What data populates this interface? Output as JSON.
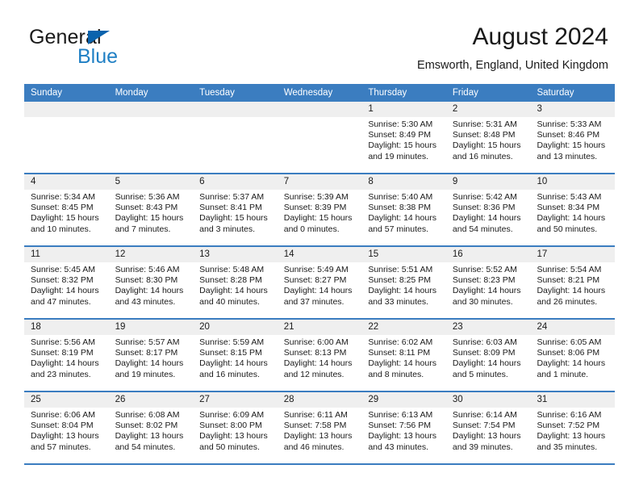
{
  "brand": {
    "name_part1": "General",
    "name_part2": "Blue",
    "flag_icon": "triangle-flag-icon"
  },
  "header": {
    "title": "August 2024",
    "subtitle": "Emsworth, England, United Kingdom"
  },
  "colors": {
    "header_blue": "#3b7dc0",
    "daynum_band": "#efefef",
    "brand_blue": "#1f7fc4",
    "brand_flag": "#0a63ad",
    "text": "#1a1a1a"
  },
  "weekdays": [
    "Sunday",
    "Monday",
    "Tuesday",
    "Wednesday",
    "Thursday",
    "Friday",
    "Saturday"
  ],
  "weeks": [
    [
      {
        "day": "",
        "empty": true,
        "lines": []
      },
      {
        "day": "",
        "empty": true,
        "lines": []
      },
      {
        "day": "",
        "empty": true,
        "lines": []
      },
      {
        "day": "",
        "empty": true,
        "lines": []
      },
      {
        "day": "1",
        "empty": false,
        "lines": [
          "Sunrise: 5:30 AM",
          "Sunset: 8:49 PM",
          "Daylight: 15 hours",
          "and 19 minutes."
        ]
      },
      {
        "day": "2",
        "empty": false,
        "lines": [
          "Sunrise: 5:31 AM",
          "Sunset: 8:48 PM",
          "Daylight: 15 hours",
          "and 16 minutes."
        ]
      },
      {
        "day": "3",
        "empty": false,
        "lines": [
          "Sunrise: 5:33 AM",
          "Sunset: 8:46 PM",
          "Daylight: 15 hours",
          "and 13 minutes."
        ]
      }
    ],
    [
      {
        "day": "4",
        "empty": false,
        "lines": [
          "Sunrise: 5:34 AM",
          "Sunset: 8:45 PM",
          "Daylight: 15 hours",
          "and 10 minutes."
        ]
      },
      {
        "day": "5",
        "empty": false,
        "lines": [
          "Sunrise: 5:36 AM",
          "Sunset: 8:43 PM",
          "Daylight: 15 hours",
          "and 7 minutes."
        ]
      },
      {
        "day": "6",
        "empty": false,
        "lines": [
          "Sunrise: 5:37 AM",
          "Sunset: 8:41 PM",
          "Daylight: 15 hours",
          "and 3 minutes."
        ]
      },
      {
        "day": "7",
        "empty": false,
        "lines": [
          "Sunrise: 5:39 AM",
          "Sunset: 8:39 PM",
          "Daylight: 15 hours",
          "and 0 minutes."
        ]
      },
      {
        "day": "8",
        "empty": false,
        "lines": [
          "Sunrise: 5:40 AM",
          "Sunset: 8:38 PM",
          "Daylight: 14 hours",
          "and 57 minutes."
        ]
      },
      {
        "day": "9",
        "empty": false,
        "lines": [
          "Sunrise: 5:42 AM",
          "Sunset: 8:36 PM",
          "Daylight: 14 hours",
          "and 54 minutes."
        ]
      },
      {
        "day": "10",
        "empty": false,
        "lines": [
          "Sunrise: 5:43 AM",
          "Sunset: 8:34 PM",
          "Daylight: 14 hours",
          "and 50 minutes."
        ]
      }
    ],
    [
      {
        "day": "11",
        "empty": false,
        "lines": [
          "Sunrise: 5:45 AM",
          "Sunset: 8:32 PM",
          "Daylight: 14 hours",
          "and 47 minutes."
        ]
      },
      {
        "day": "12",
        "empty": false,
        "lines": [
          "Sunrise: 5:46 AM",
          "Sunset: 8:30 PM",
          "Daylight: 14 hours",
          "and 43 minutes."
        ]
      },
      {
        "day": "13",
        "empty": false,
        "lines": [
          "Sunrise: 5:48 AM",
          "Sunset: 8:28 PM",
          "Daylight: 14 hours",
          "and 40 minutes."
        ]
      },
      {
        "day": "14",
        "empty": false,
        "lines": [
          "Sunrise: 5:49 AM",
          "Sunset: 8:27 PM",
          "Daylight: 14 hours",
          "and 37 minutes."
        ]
      },
      {
        "day": "15",
        "empty": false,
        "lines": [
          "Sunrise: 5:51 AM",
          "Sunset: 8:25 PM",
          "Daylight: 14 hours",
          "and 33 minutes."
        ]
      },
      {
        "day": "16",
        "empty": false,
        "lines": [
          "Sunrise: 5:52 AM",
          "Sunset: 8:23 PM",
          "Daylight: 14 hours",
          "and 30 minutes."
        ]
      },
      {
        "day": "17",
        "empty": false,
        "lines": [
          "Sunrise: 5:54 AM",
          "Sunset: 8:21 PM",
          "Daylight: 14 hours",
          "and 26 minutes."
        ]
      }
    ],
    [
      {
        "day": "18",
        "empty": false,
        "lines": [
          "Sunrise: 5:56 AM",
          "Sunset: 8:19 PM",
          "Daylight: 14 hours",
          "and 23 minutes."
        ]
      },
      {
        "day": "19",
        "empty": false,
        "lines": [
          "Sunrise: 5:57 AM",
          "Sunset: 8:17 PM",
          "Daylight: 14 hours",
          "and 19 minutes."
        ]
      },
      {
        "day": "20",
        "empty": false,
        "lines": [
          "Sunrise: 5:59 AM",
          "Sunset: 8:15 PM",
          "Daylight: 14 hours",
          "and 16 minutes."
        ]
      },
      {
        "day": "21",
        "empty": false,
        "lines": [
          "Sunrise: 6:00 AM",
          "Sunset: 8:13 PM",
          "Daylight: 14 hours",
          "and 12 minutes."
        ]
      },
      {
        "day": "22",
        "empty": false,
        "lines": [
          "Sunrise: 6:02 AM",
          "Sunset: 8:11 PM",
          "Daylight: 14 hours",
          "and 8 minutes."
        ]
      },
      {
        "day": "23",
        "empty": false,
        "lines": [
          "Sunrise: 6:03 AM",
          "Sunset: 8:09 PM",
          "Daylight: 14 hours",
          "and 5 minutes."
        ]
      },
      {
        "day": "24",
        "empty": false,
        "lines": [
          "Sunrise: 6:05 AM",
          "Sunset: 8:06 PM",
          "Daylight: 14 hours",
          "and 1 minute."
        ]
      }
    ],
    [
      {
        "day": "25",
        "empty": false,
        "lines": [
          "Sunrise: 6:06 AM",
          "Sunset: 8:04 PM",
          "Daylight: 13 hours",
          "and 57 minutes."
        ]
      },
      {
        "day": "26",
        "empty": false,
        "lines": [
          "Sunrise: 6:08 AM",
          "Sunset: 8:02 PM",
          "Daylight: 13 hours",
          "and 54 minutes."
        ]
      },
      {
        "day": "27",
        "empty": false,
        "lines": [
          "Sunrise: 6:09 AM",
          "Sunset: 8:00 PM",
          "Daylight: 13 hours",
          "and 50 minutes."
        ]
      },
      {
        "day": "28",
        "empty": false,
        "lines": [
          "Sunrise: 6:11 AM",
          "Sunset: 7:58 PM",
          "Daylight: 13 hours",
          "and 46 minutes."
        ]
      },
      {
        "day": "29",
        "empty": false,
        "lines": [
          "Sunrise: 6:13 AM",
          "Sunset: 7:56 PM",
          "Daylight: 13 hours",
          "and 43 minutes."
        ]
      },
      {
        "day": "30",
        "empty": false,
        "lines": [
          "Sunrise: 6:14 AM",
          "Sunset: 7:54 PM",
          "Daylight: 13 hours",
          "and 39 minutes."
        ]
      },
      {
        "day": "31",
        "empty": false,
        "lines": [
          "Sunrise: 6:16 AM",
          "Sunset: 7:52 PM",
          "Daylight: 13 hours",
          "and 35 minutes."
        ]
      }
    ]
  ]
}
